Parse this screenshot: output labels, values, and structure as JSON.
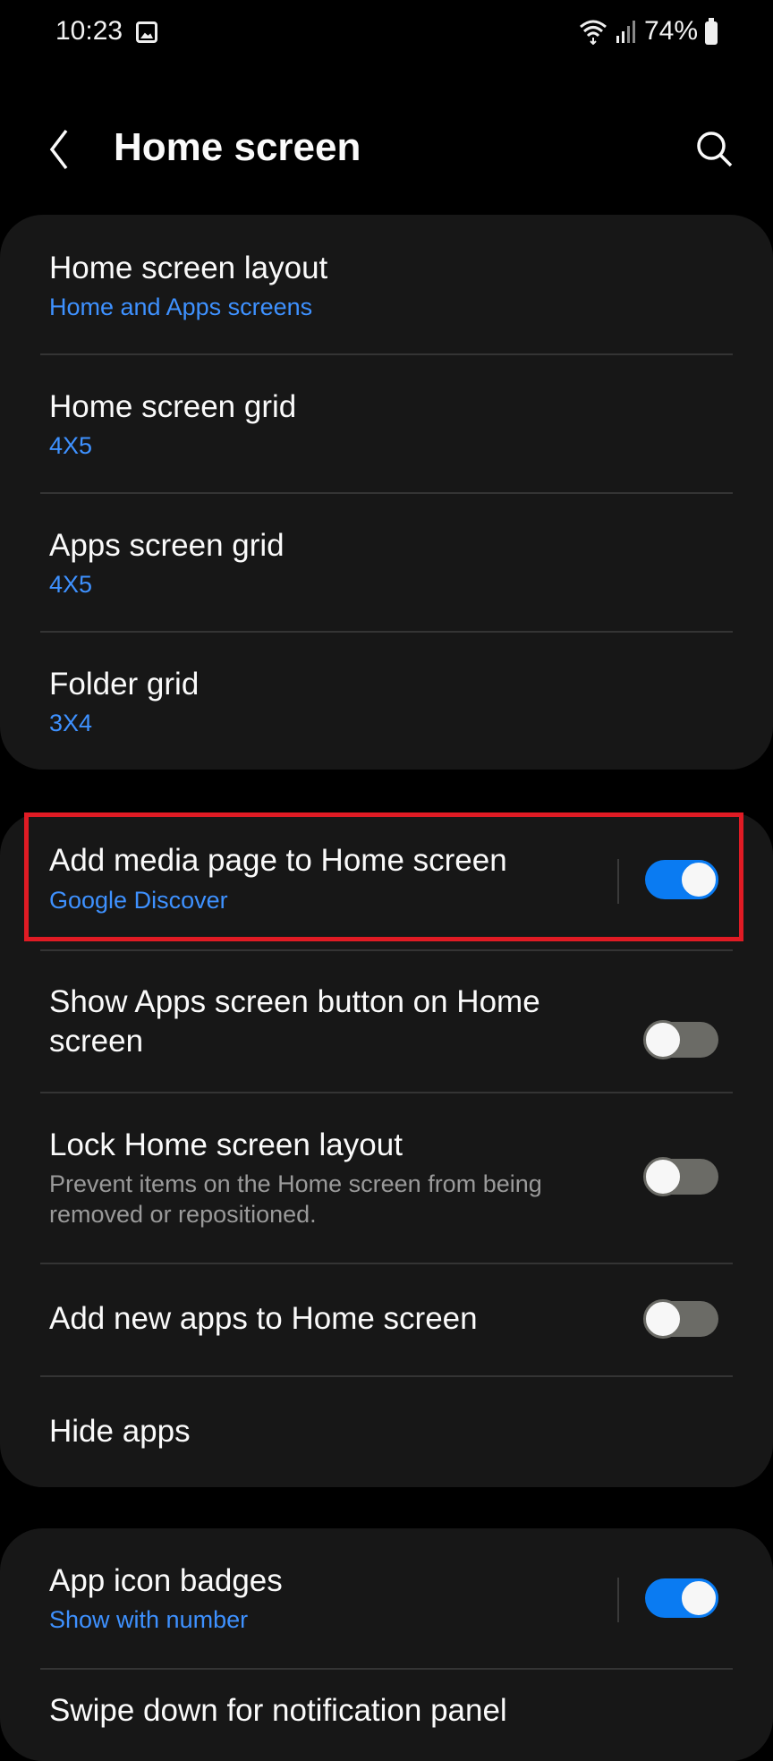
{
  "status_bar": {
    "time": "10:23",
    "battery": "74%"
  },
  "header": {
    "title": "Home screen"
  },
  "group1": [
    {
      "title": "Home screen layout",
      "subtitle": "Home and Apps screens"
    },
    {
      "title": "Home screen grid",
      "subtitle": "4X5"
    },
    {
      "title": "Apps screen grid",
      "subtitle": "4X5"
    },
    {
      "title": "Folder grid",
      "subtitle": "3X4"
    }
  ],
  "group2": [
    {
      "title": "Add media page to Home screen",
      "subtitle": "Google Discover",
      "toggle": "on"
    },
    {
      "title": "Show Apps screen button on Home screen",
      "toggle": "off"
    },
    {
      "title": "Lock Home screen layout",
      "description": "Prevent items on the Home screen from being removed or repositioned.",
      "toggle": "off"
    },
    {
      "title": "Add new apps to Home screen",
      "toggle": "off"
    },
    {
      "title": "Hide apps"
    }
  ],
  "group3": [
    {
      "title": "App icon badges",
      "subtitle": "Show with number",
      "toggle": "on"
    },
    {
      "title": "Swipe down for notification panel"
    }
  ],
  "colors": {
    "accent": "#3e91ff",
    "toggle_on": "#0a7bf2",
    "highlight": "#e01b24"
  }
}
